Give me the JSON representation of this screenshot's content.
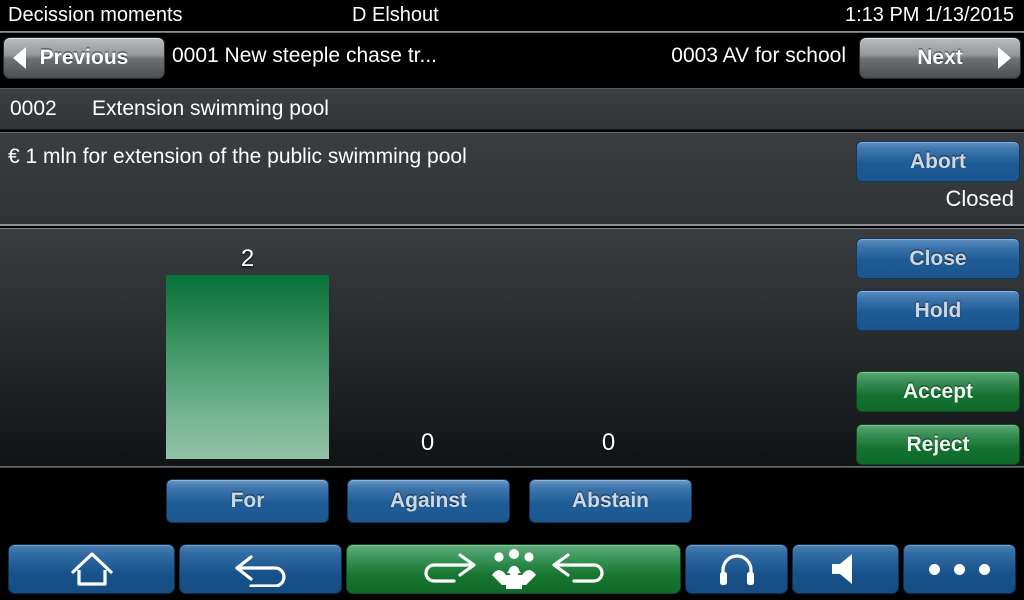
{
  "statusbar": {
    "app_title": "Decission moments",
    "user": "D Elshout",
    "datetime": "1:13 PM 1/13/2015"
  },
  "navbar": {
    "previous_label": "Previous",
    "previous_item": "0001 New steeple chase tr...",
    "next_item": "0003 AV for school",
    "next_label": "Next",
    "prev_arrow_icon": "triangle-left-icon",
    "next_arrow_icon": "triangle-right-icon"
  },
  "item": {
    "number": "0002",
    "title": "Extension swimming pool",
    "description": "€ 1 mln for extension of the public swimming pool",
    "status": "Closed"
  },
  "actions": {
    "abort": "Abort",
    "close": "Close",
    "hold": "Hold",
    "accept": "Accept",
    "reject": "Reject"
  },
  "vote_buttons": {
    "for": "For",
    "against": "Against",
    "abstain": "Abstain"
  },
  "toolbar": {
    "home_icon": "home-icon",
    "back_icon": "back-arrow-icon",
    "meeting_icon": "meeting-group-icon",
    "audio_icon": "headphones-icon",
    "volume_icon": "speaker-icon",
    "more_icon": "ellipsis-icon"
  },
  "colors": {
    "accent_blue": "#1f5c96",
    "accent_green": "#14722f",
    "bar_top": "#06713a",
    "bar_bottom": "#93c2a6",
    "panel_bg": "#33373a",
    "background": "#000000",
    "text": "#ffffff"
  },
  "chart_data": {
    "type": "bar",
    "title": "",
    "xlabel": "",
    "ylabel": "",
    "categories": [
      "For",
      "Against",
      "Abstain"
    ],
    "values": [
      2,
      0,
      0
    ],
    "ylim": [
      0,
      2
    ],
    "grid": false,
    "legend": "none",
    "labels": [
      "2",
      "0",
      "0"
    ]
  }
}
